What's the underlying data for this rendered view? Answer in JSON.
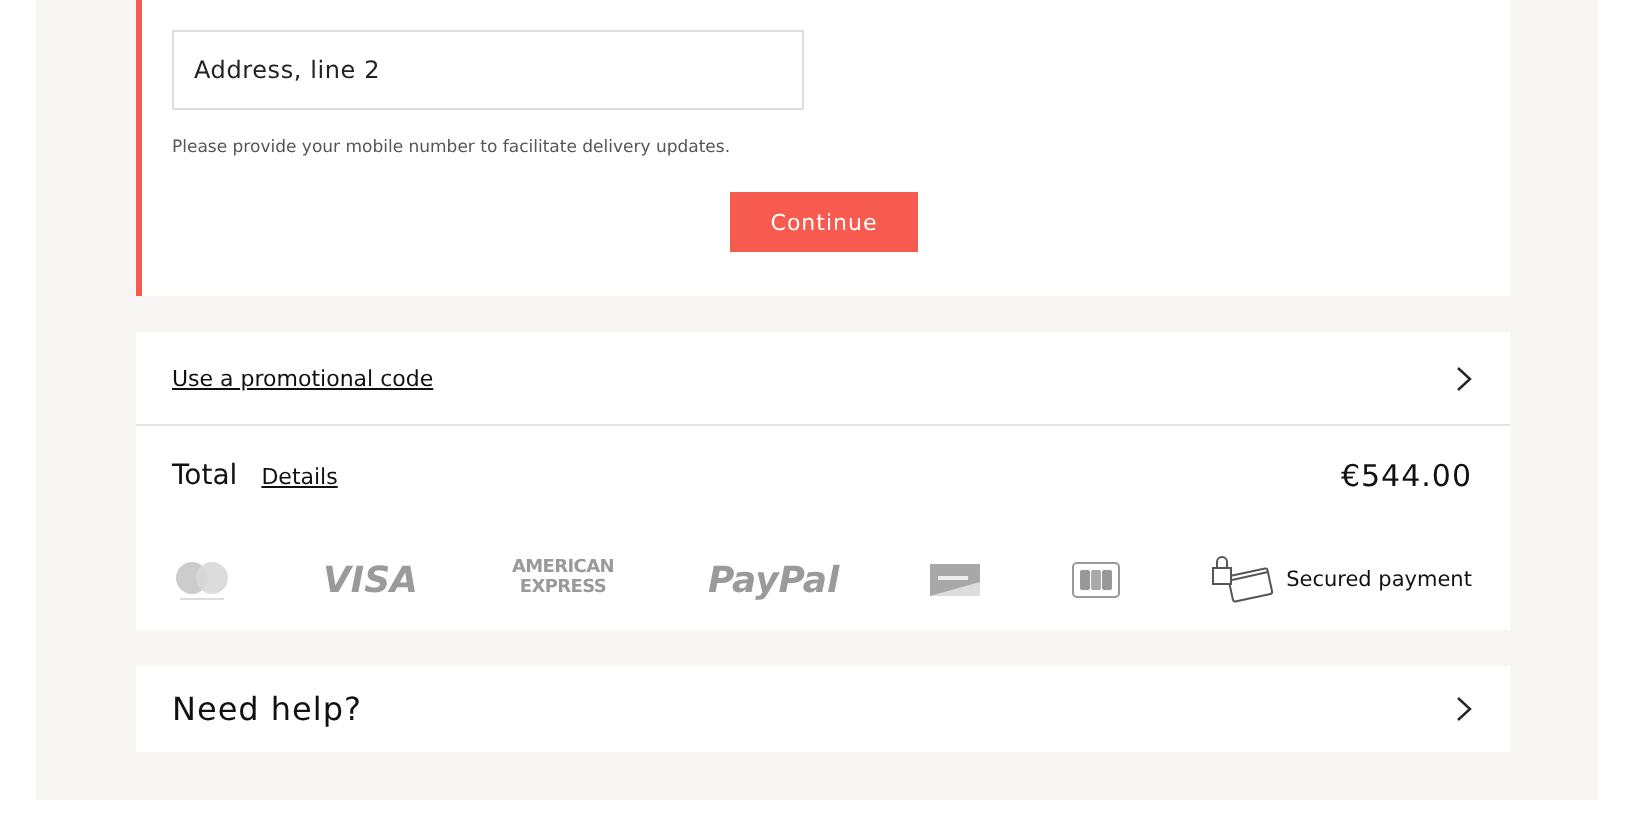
{
  "address_form": {
    "address_line_2": {
      "value": "Address, line 2"
    },
    "hint": "Please provide your mobile number to facilitate delivery updates.",
    "continue_button": "Continue"
  },
  "promo": {
    "label": "Use a promotional code"
  },
  "total": {
    "label": "Total",
    "details_link": "Details",
    "amount": "€544.00"
  },
  "payment_methods": [
    {
      "kind": "mastercard"
    },
    {
      "kind": "wordmark",
      "text": "VISA"
    },
    {
      "kind": "amex",
      "text": "AMERICAN EXPRESS"
    },
    {
      "kind": "wordmark",
      "text": "PayPal"
    },
    {
      "kind": "discover"
    },
    {
      "kind": "jcb"
    }
  ],
  "secured_payment": "Secured payment",
  "help": {
    "title": "Need help?"
  }
}
